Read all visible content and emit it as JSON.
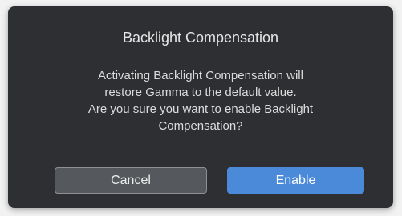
{
  "dialog": {
    "title": "Backlight Compensation",
    "message_lines": [
      "Activating Backlight Compensation will",
      "restore Gamma to the default value.",
      "Are you sure you want to enable Backlight",
      "Compensation?"
    ],
    "buttons": {
      "cancel_label": "Cancel",
      "enable_label": "Enable"
    }
  },
  "colors": {
    "dialog_background": "#2e2f33",
    "primary_button": "#4a8ad8",
    "secondary_button": "#55585d"
  }
}
